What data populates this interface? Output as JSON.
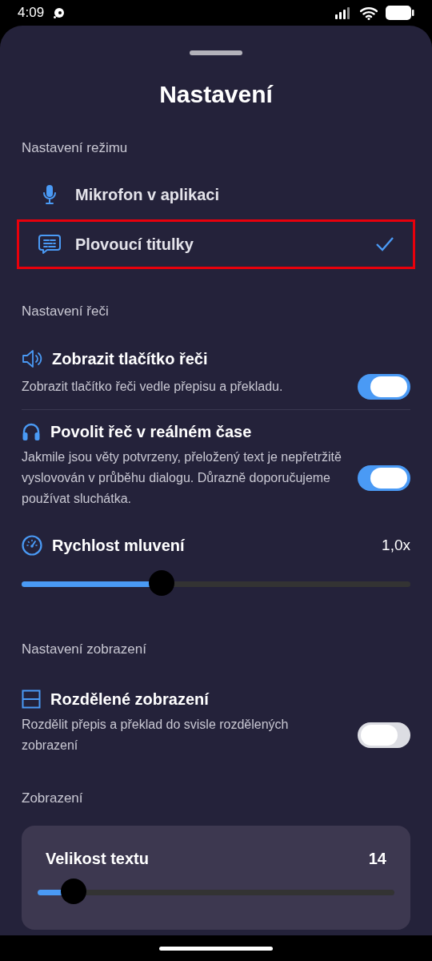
{
  "status_bar": {
    "time": "4:09"
  },
  "title": "Nastavení",
  "mode_section": {
    "heading": "Nastavení režimu",
    "options": [
      {
        "label": "Mikrofon v aplikaci",
        "selected": false
      },
      {
        "label": "Plovoucí titulky",
        "selected": true
      }
    ]
  },
  "speech_section": {
    "heading": "Nastavení řeči",
    "settings": [
      {
        "kind": "toggle",
        "title": "Zobrazit tlačítko řeči",
        "description": "Zobrazit tlačítko řeči vedle přepisu a překladu.",
        "on": true
      },
      {
        "kind": "toggle",
        "title": "Povolit řeč v reálném čase",
        "description": "Jakmile jsou věty potvrzeny, přeložený text je nepřetržitě vyslovován v průběhu dialogu. Důrazně doporučujeme používat sluchátka.",
        "on": true
      },
      {
        "kind": "slider",
        "title": "Rychlost mluvení",
        "reading": "1,0x",
        "level": 0.36
      }
    ]
  },
  "display_section": {
    "heading": "Nastavení zobrazení",
    "settings": [
      {
        "kind": "toggle",
        "title": "Rozdělené zobrazení",
        "description": "Rozdělit přepis a překlad do svisle rozdělených zobrazení",
        "on": false
      }
    ]
  },
  "view_section": {
    "heading": "Zobrazení",
    "card": {
      "title": "Velikost textu",
      "reading": "14",
      "level": 0.1
    }
  }
}
